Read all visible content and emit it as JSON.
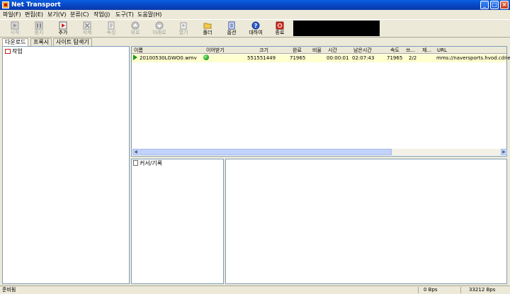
{
  "window": {
    "title": "Net Transport"
  },
  "menu": [
    {
      "label": "파일(F)"
    },
    {
      "label": "편집(E)"
    },
    {
      "label": "보기(V)"
    },
    {
      "label": "분류(C)"
    },
    {
      "label": "작업(J)"
    },
    {
      "label": "도구(T)"
    },
    {
      "label": "도움말(H)"
    }
  ],
  "toolbar": {
    "buttons": [
      {
        "label": "시작",
        "icon": "play-icon",
        "enabled": false
      },
      {
        "label": "중지",
        "icon": "stop-icon",
        "enabled": false
      },
      {
        "label": "추가",
        "icon": "add-icon",
        "enabled": true
      },
      {
        "label": "삭제",
        "icon": "delete-icon",
        "enabled": false
      },
      {
        "label": "속성",
        "icon": "properties-icon",
        "enabled": false
      },
      {
        "label": "위로",
        "icon": "up-arrow-icon",
        "enabled": false
      },
      {
        "label": "아래로",
        "icon": "down-arrow-icon",
        "enabled": false
      },
      {
        "label": "열기",
        "icon": "open-icon",
        "enabled": false
      },
      {
        "label": "폴더",
        "icon": "folder-icon",
        "enabled": true
      },
      {
        "label": "옵션",
        "icon": "options-icon",
        "enabled": true
      },
      {
        "label": "대하여",
        "icon": "help-icon",
        "enabled": true
      },
      {
        "label": "종료",
        "icon": "exit-icon",
        "enabled": true
      }
    ]
  },
  "tabs": [
    {
      "label": "다운로드",
      "active": true
    },
    {
      "label": "프록시",
      "active": false
    },
    {
      "label": "사이트 탐색기",
      "active": false
    }
  ],
  "tree": {
    "root_label": "작업"
  },
  "download_list": {
    "columns": [
      "이름",
      "이어받기",
      "크기",
      "완료",
      "비율",
      "시간",
      "남은시간",
      "속도",
      "쓰...",
      "재...",
      "URL"
    ],
    "rows": [
      {
        "name": "20100530LGWO0.wmv",
        "resume": "",
        "size": "551551449",
        "done": "71965",
        "ratio": "",
        "time": "00:00:01",
        "remaining": "02:07:43",
        "speed": "71965",
        "threads": "2/2",
        "retry": "",
        "url": "mms://naversports.hvod.cdne"
      }
    ]
  },
  "log": {
    "root_label": "커서/기록"
  },
  "statusbar": {
    "status": "준비됨",
    "speed_down": "0 Bps",
    "speed_up": "33212 Bps"
  },
  "colors": {
    "title_bar": "#0a4fd0",
    "selected_row": "#ffffd0",
    "window_bg": "#ece9d8"
  }
}
